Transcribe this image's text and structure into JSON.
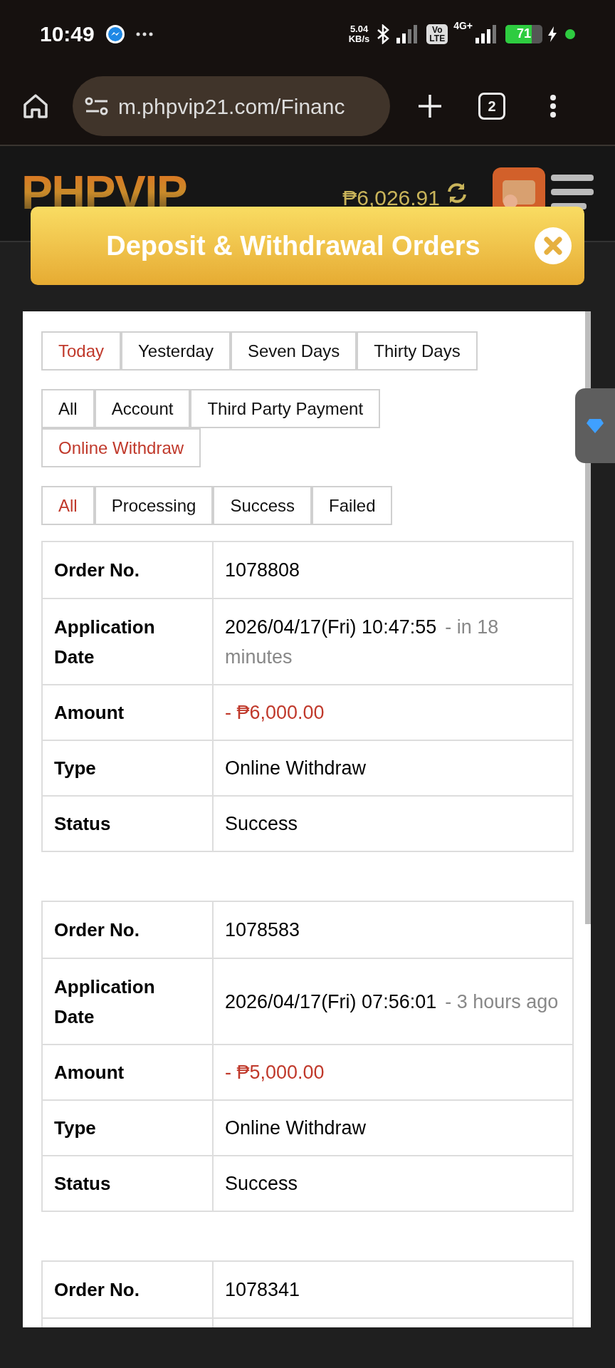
{
  "status_bar": {
    "time": "10:49",
    "speed_value": "5.04",
    "speed_unit": "KB/s",
    "volte_top": "Vo",
    "volte_bottom": "LTE",
    "network": "4G+",
    "battery": "71"
  },
  "browser": {
    "url": "m.phpvip21.com/Financ",
    "tab_count": "2"
  },
  "site_header": {
    "logo": "PHPVIP",
    "balance": "₱6,026.91"
  },
  "modal": {
    "title": "Deposit & Withdrawal Orders"
  },
  "filters": [
    [
      {
        "label": "Today",
        "selected": true
      },
      {
        "label": "Yesterday",
        "selected": false
      },
      {
        "label": "Seven Days",
        "selected": false
      },
      {
        "label": "Thirty Days",
        "selected": false
      }
    ],
    [
      {
        "label": "All",
        "selected": false
      },
      {
        "label": "Account",
        "selected": false
      },
      {
        "label": "Third Party Payment",
        "selected": false
      },
      {
        "label": "Online Withdraw",
        "selected": true
      }
    ],
    [
      {
        "label": "All",
        "selected": true
      },
      {
        "label": "Processing",
        "selected": false
      },
      {
        "label": "Success",
        "selected": false
      },
      {
        "label": "Failed",
        "selected": false
      }
    ]
  ],
  "orders": [
    {
      "rows": [
        {
          "kind": "text",
          "label": "Order No.",
          "value": "1078808"
        },
        {
          "kind": "date",
          "label": "Application Date",
          "value": "2026/04/17(Fri) 10:47:55",
          "note": "- in 18 minutes"
        },
        {
          "kind": "amount",
          "label": "Amount",
          "value": "- ₱6,000.00"
        },
        {
          "kind": "text",
          "label": "Type",
          "value": "Online Withdraw"
        },
        {
          "kind": "text",
          "label": "Status",
          "value": "Success"
        }
      ]
    },
    {
      "rows": [
        {
          "kind": "text",
          "label": "Order No.",
          "value": "1078583"
        },
        {
          "kind": "date",
          "label": "Application Date",
          "value": "2026/04/17(Fri) 07:56:01",
          "note": "- 3 hours ago"
        },
        {
          "kind": "amount",
          "label": "Amount",
          "value": "- ₱5,000.00"
        },
        {
          "kind": "text",
          "label": "Type",
          "value": "Online Withdraw"
        },
        {
          "kind": "text",
          "label": "Status",
          "value": "Success"
        }
      ]
    },
    {
      "rows": [
        {
          "kind": "text",
          "label": "Order No.",
          "value": "1078341"
        }
      ]
    }
  ]
}
